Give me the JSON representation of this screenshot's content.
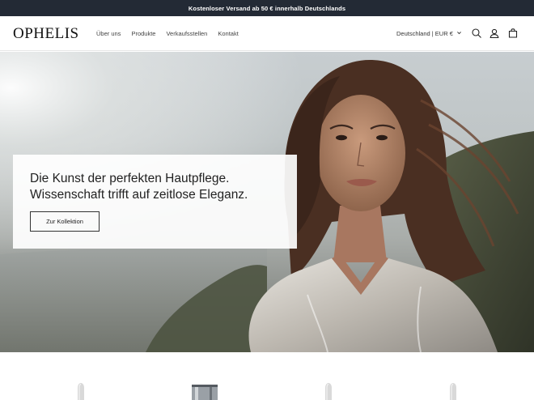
{
  "announcement": "Kostenloser Versand ab 50 € innerhalb Deutschlands",
  "brand": "OPHELIS",
  "nav": [
    "Über uns",
    "Produkte",
    "Verkaufsstellen",
    "Kontakt"
  ],
  "region": "Deutschland | EUR €",
  "icons": [
    "search-icon",
    "account-icon",
    "cart-icon",
    "chevron-down-icon"
  ],
  "hero": {
    "line1": "Die Kunst der perfekten Hautpflege.",
    "line2": "Wissenschaft trifft auf zeitlose Eleganz.",
    "button": "Zur Kollektion"
  },
  "colors": {
    "announce_bg": "#232a35",
    "text": "#1f1f1f"
  }
}
